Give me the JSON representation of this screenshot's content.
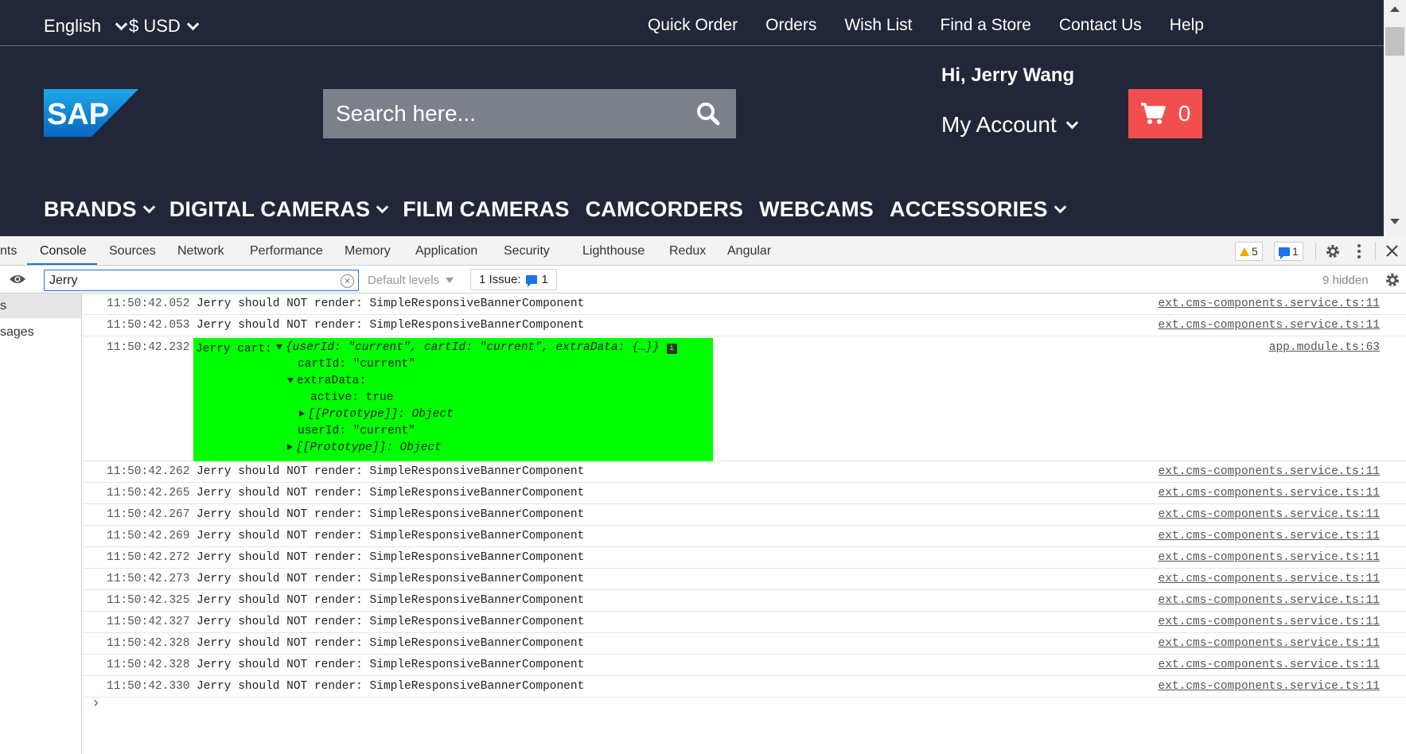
{
  "site": {
    "language": "English",
    "currency": "$ USD",
    "top_links": [
      "Quick Order",
      "Orders",
      "Wish List",
      "Find a Store",
      "Contact Us",
      "Help"
    ],
    "logo_text": "SAP",
    "search_placeholder": "Search here...",
    "greeting": "Hi, Jerry Wang",
    "account_label": "My Account",
    "cart_count": "0",
    "nav": [
      {
        "label": "BRANDS",
        "dropdown": true
      },
      {
        "label": "DIGITAL CAMERAS",
        "dropdown": true
      },
      {
        "label": "FILM CAMERAS",
        "dropdown": false
      },
      {
        "label": "CAMCORDERS",
        "dropdown": false
      },
      {
        "label": "WEBCAMS",
        "dropdown": false
      },
      {
        "label": "ACCESSORIES",
        "dropdown": true
      }
    ],
    "colors": {
      "header_bg": "#212738",
      "cart_bg": "#f24e4e",
      "search_bg": "#7b808b"
    }
  },
  "devtools": {
    "tabs": [
      "nts",
      "Console",
      "Sources",
      "Network",
      "Performance",
      "Memory",
      "Application",
      "Security",
      "Lighthouse",
      "Redux",
      "Angular"
    ],
    "active_tab": "Console",
    "warnings_count": "5",
    "messages_count": "1",
    "filter_value": "Jerry",
    "default_levels": "Default levels",
    "issues_label": "1 Issue:",
    "issues_count": "1",
    "hidden_count": "9 hidden",
    "sidebar_selected": "s",
    "sidebar_item": "sages",
    "cart_log": {
      "timestamp": "11:50:42.232",
      "label": "Jerry cart:",
      "summary": "{userId: \"current\", cartId: \"current\", extraData: {…}}",
      "source": "app.module.ts:63",
      "lines": {
        "cartId": "cartId: \"current\"",
        "extraData": "extraData:",
        "active": "active: true",
        "proto1": "[[Prototype]]: Object",
        "userId": "userId: \"current\"",
        "proto2": "[[Prototype]]: Object"
      }
    },
    "logs": [
      {
        "ts": "11:50:42.052",
        "msg": "Jerry should NOT render: SimpleResponsiveBannerComponent",
        "src": "ext.cms-components.service.ts:11"
      },
      {
        "ts": "11:50:42.053",
        "msg": "Jerry should NOT render: SimpleResponsiveBannerComponent",
        "src": "ext.cms-components.service.ts:11"
      },
      {
        "ts": "11:50:42.262",
        "msg": "Jerry should NOT render: SimpleResponsiveBannerComponent",
        "src": "ext.cms-components.service.ts:11"
      },
      {
        "ts": "11:50:42.265",
        "msg": "Jerry should NOT render: SimpleResponsiveBannerComponent",
        "src": "ext.cms-components.service.ts:11"
      },
      {
        "ts": "11:50:42.267",
        "msg": "Jerry should NOT render: SimpleResponsiveBannerComponent",
        "src": "ext.cms-components.service.ts:11"
      },
      {
        "ts": "11:50:42.269",
        "msg": "Jerry should NOT render: SimpleResponsiveBannerComponent",
        "src": "ext.cms-components.service.ts:11"
      },
      {
        "ts": "11:50:42.272",
        "msg": "Jerry should NOT render: SimpleResponsiveBannerComponent",
        "src": "ext.cms-components.service.ts:11"
      },
      {
        "ts": "11:50:42.273",
        "msg": "Jerry should NOT render: SimpleResponsiveBannerComponent",
        "src": "ext.cms-components.service.ts:11"
      },
      {
        "ts": "11:50:42.325",
        "msg": "Jerry should NOT render: SimpleResponsiveBannerComponent",
        "src": "ext.cms-components.service.ts:11"
      },
      {
        "ts": "11:50:42.327",
        "msg": "Jerry should NOT render: SimpleResponsiveBannerComponent",
        "src": "ext.cms-components.service.ts:11"
      },
      {
        "ts": "11:50:42.328",
        "msg": "Jerry should NOT render: SimpleResponsiveBannerComponent",
        "src": "ext.cms-components.service.ts:11"
      },
      {
        "ts": "11:50:42.328",
        "msg": "Jerry should NOT render: SimpleResponsiveBannerComponent",
        "src": "ext.cms-components.service.ts:11"
      },
      {
        "ts": "11:50:42.330",
        "msg": "Jerry should NOT render: SimpleResponsiveBannerComponent",
        "src": "ext.cms-components.service.ts:11"
      }
    ],
    "prompt_symbol": "›"
  }
}
